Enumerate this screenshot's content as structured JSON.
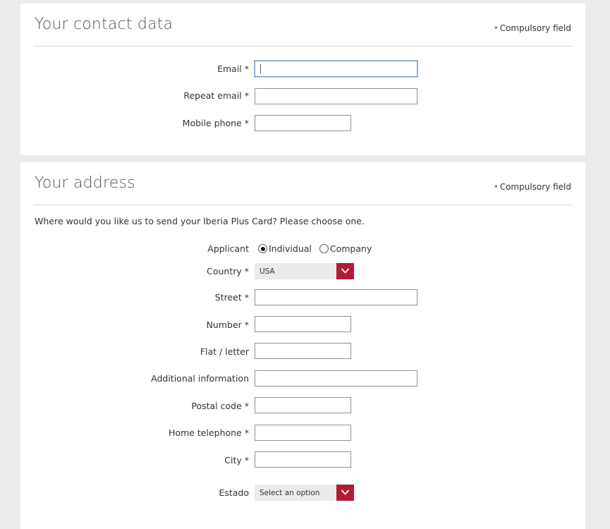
{
  "contact": {
    "title": "Your contact data",
    "compulsory_star": "*",
    "compulsory_text": "Compulsory field",
    "email_label": "Email *",
    "repeat_email_label": "Repeat email *",
    "mobile_label": "Mobile phone *"
  },
  "address": {
    "title": "Your address",
    "compulsory_star": "*",
    "compulsory_text": "Compulsory field",
    "intro": "Where would you like us to send your Iberia Plus Card? Please choose one.",
    "applicant_label": "Applicant",
    "applicant_options": [
      "Individual",
      "Company"
    ],
    "applicant_selected": "Individual",
    "country_label": "Country *",
    "country_value": "USA",
    "street_label": "Street *",
    "number_label": "Number *",
    "flat_label": "Flat / letter",
    "additional_label": "Additional information",
    "postal_label": "Postal code *",
    "home_phone_label": "Home telephone *",
    "city_label": "City *",
    "estado_label": "Estado",
    "estado_value": "Select an option"
  },
  "colors": {
    "accent": "#b21c33",
    "background": "#ececec",
    "panel": "#ffffff"
  }
}
